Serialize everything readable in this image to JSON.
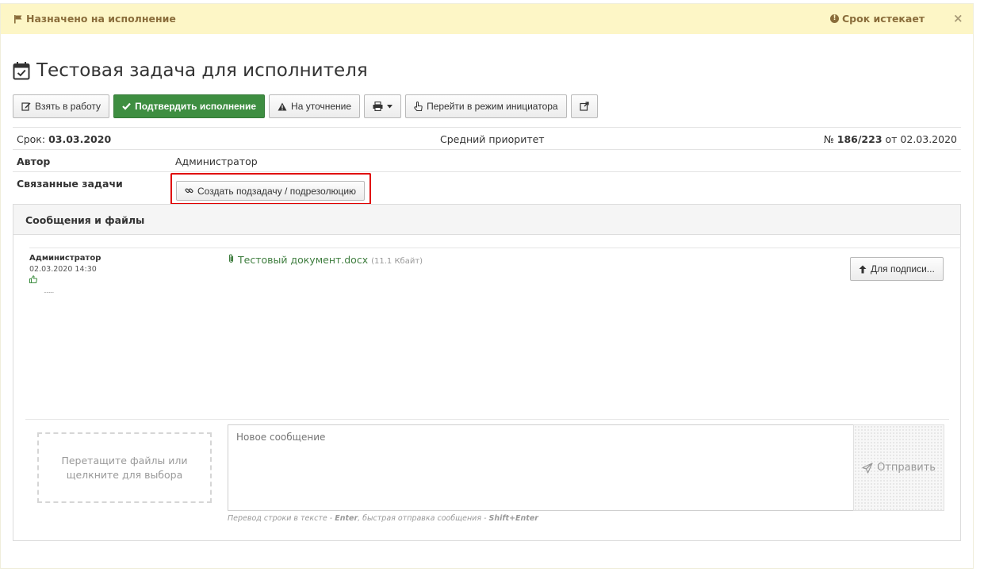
{
  "alert": {
    "left_text": "Назначено на исполнение",
    "right_text": "Срок истекает",
    "close": "×"
  },
  "task": {
    "title": "Тестовая задача для исполнителя"
  },
  "toolbar": {
    "take_label": "Взять в работу",
    "confirm_label": "Подтвердить исполнение",
    "clarify_label": "На уточнение",
    "initiator_label": "Перейти в режим инициатора"
  },
  "info": {
    "deadline_label": "Срок:",
    "deadline_value": "03.03.2020",
    "priority": "Средний приоритет",
    "number_prefix": "№",
    "number_value": "186/223",
    "number_date": "от 02.03.2020",
    "author_label": "Автор",
    "author_value": "Администратор",
    "related_label": "Связанные задачи",
    "create_subtask_label": "Создать подзадачу / подрезолюцию"
  },
  "messages": {
    "panel_title": "Сообщения и файлы",
    "items": [
      {
        "author": "Администратор",
        "date": "02.03.2020 14:30",
        "dots": "........",
        "file_name": "Тестовый документ.docx",
        "file_size": "(11.1 Кбайт)",
        "sign_label": "Для подписи..."
      }
    ]
  },
  "compose": {
    "dropzone_line1": "Перетащите файлы или",
    "dropzone_line2": "щелкните для выбора",
    "placeholder": "Новое сообщение",
    "send_label": "Отправить",
    "hint_a": "Перевод строки в тексте - ",
    "hint_enter": "Enter",
    "hint_b": ", быстрая отправка сообщения - ",
    "hint_shift": "Shift+Enter"
  },
  "colors": {
    "alert_bg": "#fdf6c6",
    "alert_text": "#8a6d3b",
    "success": "#3e8e41",
    "highlight": "#e00000",
    "link": "#3e7d3e"
  }
}
